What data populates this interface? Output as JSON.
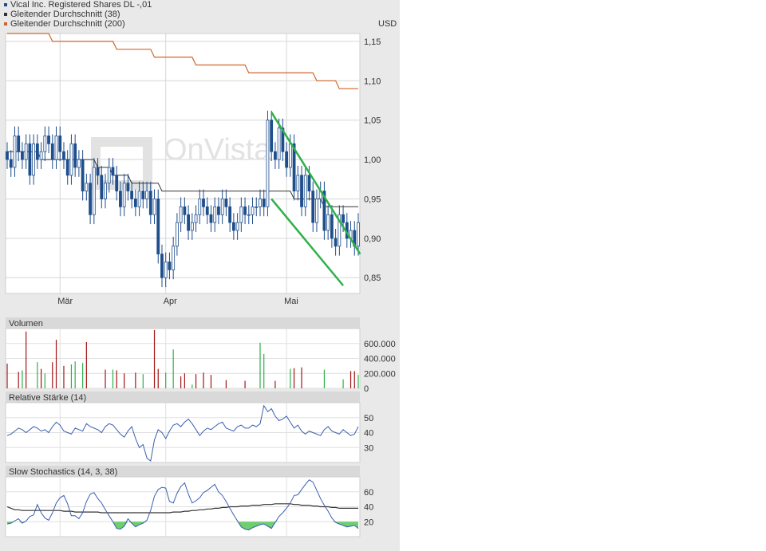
{
  "legend": {
    "items": [
      {
        "label": "Vical Inc. Registered Shares DL -,01",
        "color": "#1f4e8c"
      },
      {
        "label": "Gleitender Durchschnitt (38)",
        "color": "#333333"
      },
      {
        "label": "Gleitender Durchschnitt (200)",
        "color": "#d0652b"
      }
    ]
  },
  "watermark": "OnVista",
  "chart_data": [
    {
      "type": "candlestick",
      "currency": "USD",
      "y_ticks": [
        "1,15",
        "1,10",
        "1,05",
        "1,00",
        "0,95",
        "0,90",
        "0,85"
      ],
      "y_tick_values": [
        1.15,
        1.1,
        1.05,
        1.0,
        0.95,
        0.9,
        0.85
      ],
      "ylim": [
        0.83,
        1.16
      ],
      "x_labels": [
        "Mär",
        "Apr",
        "Mai"
      ],
      "colors": {
        "candle": "#1f4e8c",
        "ma38": "#333333",
        "ma200": "#d0652b",
        "channel": "#2eb04a"
      },
      "closes": [
        1.0,
        0.99,
        1.03,
        1.01,
        1.0,
        1.02,
        0.98,
        1.02,
        1.0,
        1.01,
        1.03,
        1.02,
        1.0,
        1.03,
        1.01,
        1.0,
        0.98,
        1.02,
        0.99,
        1.0,
        0.96,
        0.97,
        0.93,
        0.99,
        0.98,
        0.95,
        0.97,
        0.99,
        0.98,
        0.96,
        0.94,
        0.97,
        0.96,
        0.95,
        0.94,
        0.96,
        0.95,
        0.96,
        0.93,
        0.95,
        0.88,
        0.85,
        0.87,
        0.86,
        0.89,
        0.92,
        0.94,
        0.93,
        0.91,
        0.92,
        0.93,
        0.95,
        0.94,
        0.93,
        0.92,
        0.94,
        0.93,
        0.95,
        0.94,
        0.92,
        0.91,
        0.92,
        0.94,
        0.93,
        0.93,
        0.94,
        0.94,
        0.95,
        0.94,
        1.05,
        1.01,
        1.0,
        1.04,
        1.01,
        0.99,
        1.02,
        0.96,
        0.98,
        0.94,
        0.98,
        0.96,
        0.92,
        0.95,
        0.96,
        0.91,
        0.93,
        0.9,
        0.89,
        0.93,
        0.92,
        0.9,
        0.91,
        0.89,
        0.92
      ],
      "ma38": [
        1.01,
        1.01,
        1.01,
        1.01,
        1.01,
        1.01,
        1.01,
        1.01,
        1.01,
        1.0,
        1.0,
        1.0,
        1.0,
        1.0,
        1.0,
        1.0,
        1.0,
        1.0,
        1.0,
        1.0,
        1.0,
        1.0,
        1.0,
        1.0,
        0.99,
        0.99,
        0.99,
        0.99,
        0.98,
        0.98,
        0.98,
        0.98,
        0.98,
        0.97,
        0.97,
        0.97,
        0.97,
        0.97,
        0.97,
        0.97,
        0.97,
        0.96,
        0.96,
        0.96,
        0.96,
        0.96,
        0.96,
        0.96,
        0.96,
        0.96,
        0.96,
        0.96,
        0.96,
        0.96,
        0.96,
        0.96,
        0.96,
        0.96,
        0.96,
        0.96,
        0.96,
        0.96,
        0.96,
        0.96,
        0.96,
        0.96,
        0.96,
        0.96,
        0.96,
        0.96,
        0.96,
        0.96,
        0.96,
        0.96,
        0.96,
        0.96,
        0.95,
        0.95,
        0.95,
        0.95,
        0.95,
        0.95,
        0.95,
        0.95,
        0.94,
        0.94,
        0.94,
        0.94,
        0.94,
        0.94,
        0.94,
        0.94,
        0.94,
        0.94
      ],
      "ma200": [
        1.16,
        1.16,
        1.16,
        1.16,
        1.16,
        1.16,
        1.16,
        1.16,
        1.16,
        1.16,
        1.16,
        1.16,
        1.15,
        1.15,
        1.15,
        1.15,
        1.15,
        1.15,
        1.15,
        1.15,
        1.15,
        1.15,
        1.15,
        1.15,
        1.15,
        1.15,
        1.15,
        1.15,
        1.15,
        1.14,
        1.14,
        1.14,
        1.14,
        1.14,
        1.14,
        1.14,
        1.14,
        1.14,
        1.14,
        1.13,
        1.13,
        1.13,
        1.13,
        1.13,
        1.13,
        1.13,
        1.13,
        1.13,
        1.13,
        1.13,
        1.12,
        1.12,
        1.12,
        1.12,
        1.12,
        1.12,
        1.12,
        1.12,
        1.12,
        1.12,
        1.12,
        1.12,
        1.12,
        1.12,
        1.11,
        1.11,
        1.11,
        1.11,
        1.11,
        1.11,
        1.11,
        1.11,
        1.11,
        1.11,
        1.11,
        1.11,
        1.11,
        1.11,
        1.11,
        1.11,
        1.11,
        1.11,
        1.1,
        1.1,
        1.1,
        1.1,
        1.1,
        1.1,
        1.09,
        1.09,
        1.09,
        1.09,
        1.09,
        1.09
      ],
      "channel": {
        "upper": [
          [
            1.06,
            70
          ],
          [
            0.88,
            93.5
          ]
        ],
        "lower": [
          [
            0.95,
            70
          ],
          [
            0.84,
            89
          ]
        ]
      }
    },
    {
      "type": "bar",
      "title": "Volumen",
      "y_ticks": [
        "600.000",
        "400.000",
        "200.000",
        "0"
      ],
      "y_tick_values": [
        600000,
        400000,
        200000,
        0
      ],
      "ylim": [
        0,
        800000
      ],
      "up_color": "#2eb04a",
      "down_color": "#a31515",
      "values": [
        330000,
        0,
        0,
        220000,
        240000,
        760000,
        0,
        0,
        350000,
        260000,
        200000,
        0,
        350000,
        650000,
        0,
        300000,
        0,
        320000,
        360000,
        0,
        340000,
        620000,
        0,
        0,
        0,
        0,
        250000,
        0,
        250000,
        240000,
        0,
        200000,
        0,
        0,
        210000,
        0,
        190000,
        0,
        0,
        780000,
        260000,
        0,
        210000,
        0,
        520000,
        0,
        160000,
        200000,
        0,
        50000,
        190000,
        0,
        210000,
        0,
        180000,
        0,
        0,
        0,
        110000,
        0,
        0,
        0,
        0,
        100000,
        0,
        0,
        0,
        610000,
        460000,
        0,
        0,
        100000,
        0,
        0,
        0,
        260000,
        270000,
        0,
        280000,
        0,
        0,
        0,
        0,
        0,
        250000,
        0,
        0,
        0,
        0,
        120000,
        0,
        230000,
        230000,
        180000
      ],
      "up": [
        0,
        0,
        0,
        0,
        1,
        0,
        0,
        0,
        1,
        0,
        1,
        0,
        0,
        0,
        0,
        0,
        0,
        1,
        1,
        0,
        1,
        0,
        0,
        0,
        0,
        0,
        0,
        0,
        1,
        0,
        0,
        0,
        0,
        0,
        0,
        0,
        1,
        0,
        0,
        0,
        0,
        0,
        1,
        0,
        1,
        0,
        0,
        0,
        0,
        1,
        0,
        0,
        0,
        0,
        0,
        0,
        0,
        0,
        0,
        0,
        0,
        0,
        0,
        0,
        0,
        0,
        0,
        1,
        1,
        0,
        0,
        0,
        0,
        0,
        0,
        1,
        0,
        0,
        0,
        0,
        0,
        0,
        0,
        0,
        1,
        0,
        0,
        0,
        0,
        1,
        0,
        0,
        0,
        1
      ]
    },
    {
      "type": "line",
      "title": "Relative Stärke (14)",
      "y_ticks": [
        "50",
        "40",
        "30"
      ],
      "y_tick_values": [
        50,
        40,
        30
      ],
      "ylim": [
        20,
        60
      ],
      "color": "#3b5fb0",
      "values": [
        38,
        39,
        41,
        43,
        42,
        40,
        42,
        44,
        43,
        41,
        42,
        40,
        44,
        47,
        45,
        41,
        40,
        39,
        43,
        42,
        41,
        46,
        44,
        43,
        42,
        40,
        44,
        46,
        45,
        42,
        39,
        37,
        41,
        44,
        36,
        30,
        32,
        23,
        21,
        35,
        42,
        40,
        36,
        41,
        45,
        46,
        44,
        47,
        49,
        46,
        42,
        38,
        41,
        43,
        42,
        44,
        46,
        47,
        43,
        42,
        41,
        44,
        45,
        43,
        43,
        45,
        44,
        46,
        58,
        54,
        56,
        51,
        48,
        49,
        51,
        47,
        43,
        45,
        41,
        39,
        41,
        40,
        39,
        38,
        42,
        44,
        41,
        40,
        39,
        42,
        40,
        38,
        39,
        44
      ]
    },
    {
      "type": "line",
      "title": "Slow Stochastics (14, 3, 38)",
      "y_ticks": [
        "60",
        "40",
        "20"
      ],
      "y_tick_values": [
        60,
        40,
        20
      ],
      "ylim": [
        0,
        80
      ],
      "fast_color": "#3b5fb0",
      "slow_color": "#333333",
      "fill_color": "#6fcf6f",
      "fast": [
        17,
        18,
        21,
        24,
        18,
        21,
        27,
        29,
        43,
        32,
        25,
        22,
        32,
        45,
        52,
        55,
        44,
        28,
        28,
        24,
        32,
        47,
        57,
        59,
        51,
        45,
        36,
        28,
        20,
        11,
        10,
        14,
        24,
        18,
        13,
        16,
        18,
        22,
        35,
        54,
        63,
        66,
        65,
        47,
        45,
        58,
        67,
        72,
        57,
        45,
        48,
        52,
        59,
        62,
        66,
        70,
        60,
        55,
        47,
        38,
        29,
        21,
        13,
        10,
        9,
        12,
        14,
        16,
        17,
        14,
        11,
        19,
        27,
        32,
        38,
        45,
        55,
        56,
        63,
        70,
        76,
        73,
        62,
        51,
        42,
        34,
        25,
        19,
        17,
        15,
        13,
        14,
        15,
        11
      ],
      "slow": [
        40,
        38,
        36,
        36,
        35,
        35,
        35,
        35,
        35,
        35,
        35,
        35,
        35,
        35,
        35,
        34,
        34,
        34,
        33,
        33,
        33,
        33,
        33,
        33,
        33,
        32,
        32,
        32,
        32,
        32,
        32,
        32,
        32,
        32,
        32,
        32,
        32,
        32,
        32,
        32,
        32,
        32,
        32,
        32,
        33,
        33,
        33,
        34,
        34,
        35,
        35,
        36,
        36,
        37,
        37,
        38,
        38,
        39,
        39,
        40,
        40,
        40,
        41,
        41,
        41,
        42,
        42,
        42,
        43,
        43,
        43,
        44,
        44,
        44,
        44,
        44,
        43,
        43,
        42,
        42,
        42,
        41,
        41,
        40,
        40,
        40,
        39,
        39,
        38,
        38,
        38,
        38,
        38,
        38
      ]
    }
  ]
}
